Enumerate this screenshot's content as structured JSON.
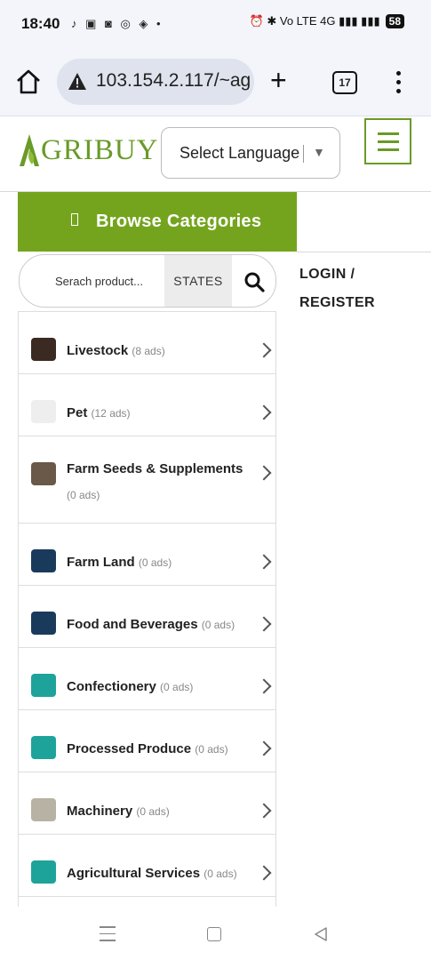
{
  "status_bar": {
    "time": "18:40",
    "left_icons": "♪ ▣ ◙ ◎ ◈ •",
    "right_icons": "⏰ ✱ Vo LTE 4G ▮▮▮ ▮▮▮",
    "battery": "58"
  },
  "browser": {
    "url": "103.154.2.117/~ag",
    "tab_count": "17"
  },
  "header": {
    "logo_text": "GRIBUY",
    "language_label": "Select Language",
    "language_arrow": "▼"
  },
  "sidebar": {
    "browse_title": "Browse Categories",
    "search_placeholder": "Serach product...",
    "states_label": "STATES",
    "categories": [
      {
        "name": "Livestock",
        "count": "(8 ads)",
        "thumb": "#3a2a22"
      },
      {
        "name": "Pet",
        "count": "(12 ads)",
        "thumb": "#eeeeee"
      },
      {
        "name": "Farm Seeds & Supplements",
        "count": "(0 ads)",
        "thumb": "#6a5848"
      },
      {
        "name": "Farm Land",
        "count": "(0 ads)",
        "thumb": "#1a3a5c"
      },
      {
        "name": "Food and Beverages",
        "count": "(0 ads)",
        "thumb": "#1a3a5c"
      },
      {
        "name": "Confectionery",
        "count": "(0 ads)",
        "thumb": "#1ea39a"
      },
      {
        "name": "Processed Produce",
        "count": "(0 ads)",
        "thumb": "#1ea39a"
      },
      {
        "name": "Machinery",
        "count": "(0 ads)",
        "thumb": "#b8b2a4"
      },
      {
        "name": "Agricultural Services",
        "count": "(0 ads)",
        "thumb": "#1ea39a"
      }
    ]
  },
  "auth": {
    "login_label": "LOGIN /",
    "register_label": "REGISTER"
  },
  "colors": {
    "brand_green": "#74a41e",
    "logo_green": "#6a9a28"
  }
}
